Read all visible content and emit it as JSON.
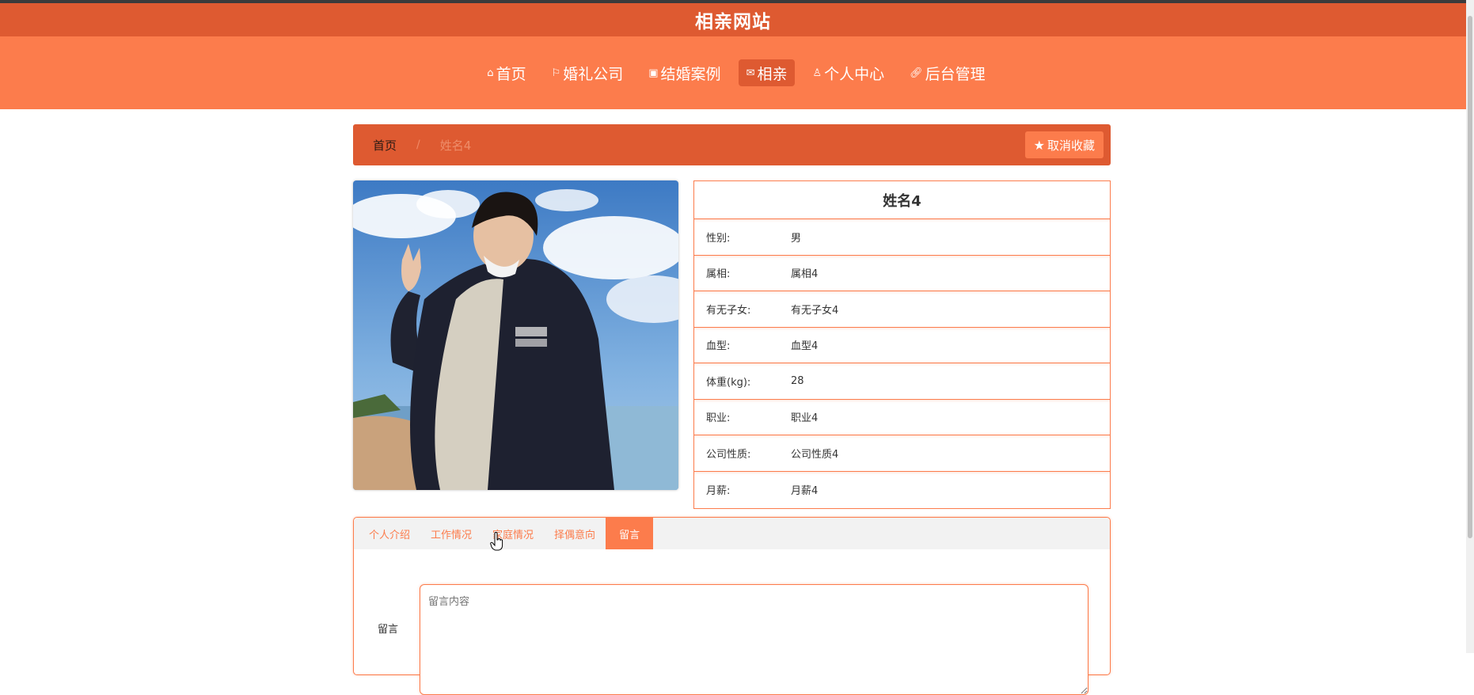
{
  "header": {
    "site_title": "相亲网站"
  },
  "nav": {
    "items": [
      {
        "label": "首页",
        "icon": "home-icon"
      },
      {
        "label": "婚礼公司",
        "icon": "flag-icon"
      },
      {
        "label": "结婚案例",
        "icon": "gift-icon"
      },
      {
        "label": "相亲",
        "icon": "mail-icon"
      },
      {
        "label": "个人中心",
        "icon": "user-icon"
      },
      {
        "label": "后台管理",
        "icon": "link-icon"
      }
    ],
    "active_index": 3
  },
  "breadcrumb": {
    "home": "首页",
    "separator": "/",
    "current": "姓名4"
  },
  "actions": {
    "unfavorite_label": "取消收藏"
  },
  "profile": {
    "name": "姓名4",
    "fields": [
      {
        "label": "性别:",
        "value": "男"
      },
      {
        "label": "属相:",
        "value": "属相4"
      },
      {
        "label": "有无子女:",
        "value": "有无子女4"
      },
      {
        "label": "血型:",
        "value": "血型4"
      },
      {
        "label": "体重(kg):",
        "value": "28"
      },
      {
        "label": "职业:",
        "value": "职业4"
      },
      {
        "label": "公司性质:",
        "value": "公司性质4"
      },
      {
        "label": "月薪:",
        "value": "月薪4"
      }
    ]
  },
  "tabs": {
    "items": [
      "个人介绍",
      "工作情况",
      "家庭情况",
      "择偶意向",
      "留言"
    ],
    "active_index": 4
  },
  "message": {
    "label": "留言",
    "placeholder": "留言内容"
  },
  "colors": {
    "primary": "#fc7c4c",
    "dark": "#de5a31"
  }
}
